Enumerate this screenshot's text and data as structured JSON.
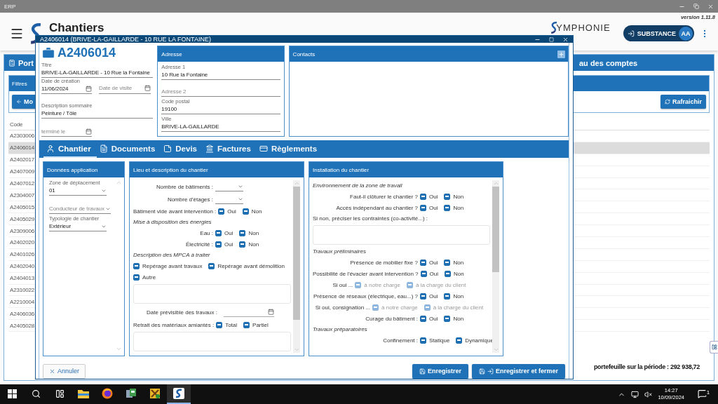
{
  "os_window": {
    "title": "ERP"
  },
  "header": {
    "app_title": "Chantiers",
    "brand": "YMPHONIE",
    "version": "version 1.11.8",
    "company_button": "SUBSTANCE",
    "avatar": "AA"
  },
  "background": {
    "left_header": "Port",
    "right_header": "au des comptes",
    "filters_title": "Filtres",
    "back_button": "Mo",
    "refresh_button": "Rafraichir",
    "column": "Code",
    "rows": [
      {
        "code": "A2303006",
        "selected": false
      },
      {
        "code": "A2406014",
        "selected": true
      },
      {
        "code": "A2402017",
        "selected": false
      },
      {
        "code": "A2407009",
        "selected": false
      },
      {
        "code": "A2407012",
        "selected": false
      },
      {
        "code": "A2304007",
        "selected": false
      },
      {
        "code": "A2405015",
        "selected": false
      },
      {
        "code": "A2405029",
        "selected": false
      },
      {
        "code": "A2309006",
        "selected": false
      },
      {
        "code": "A2402020",
        "selected": false
      },
      {
        "code": "A2401026",
        "selected": false
      },
      {
        "code": "A2402040",
        "selected": false
      },
      {
        "code": "A2404013",
        "selected": false
      },
      {
        "code": "A2310022",
        "selected": false
      },
      {
        "code": "A2210004",
        "selected": false
      },
      {
        "code": "A2406036",
        "selected": false
      },
      {
        "code": "A2405028",
        "selected": false
      }
    ],
    "total": "portefeuille sur la période : 292 938,72"
  },
  "modal": {
    "title": "A2406014 (BRIVE-LA-GAILLARDE - 10 RUE LA FONTAINE)",
    "code": "A2406014",
    "title_field": {
      "label": "Titre",
      "value": "BRIVE-LA-GAILLARDE - 10 Rue la Fontaine"
    },
    "created_field": {
      "label": "Date de création",
      "value": "11/06/2024"
    },
    "visit_field": {
      "placeholder": "Date de visite"
    },
    "summary_field": {
      "label": "Description sommaire",
      "value": "Peinture / Tôle"
    },
    "finished_field": {
      "placeholder": "terminé le"
    },
    "address": {
      "title": "Adresse",
      "fields": [
        {
          "label": "Adresse 1",
          "value": "10 Rue la Fontaine"
        },
        {
          "placeholder": "Adresse 2"
        },
        {
          "label": "Code postal",
          "value": "19100"
        },
        {
          "label": "Ville",
          "value": "BRIVE-LA-GAILLARDE"
        }
      ]
    },
    "contacts": {
      "title": "Contacts"
    },
    "tabs": [
      {
        "label": "Chantier",
        "selected": true
      },
      {
        "label": "Documents",
        "selected": false
      },
      {
        "label": "Devis",
        "selected": false
      },
      {
        "label": "Factures",
        "selected": false
      },
      {
        "label": "Règlements",
        "selected": false
      }
    ],
    "app_panel": {
      "title": "Données application",
      "fields": [
        {
          "label": "Zone de déplacement",
          "value": "01"
        },
        {
          "placeholder": "Conducteur de travaux"
        },
        {
          "label": "Typologie de chantier",
          "value": "Extérieur"
        }
      ]
    },
    "site_panel": {
      "title": "Lieu et description du chantier",
      "rows": [
        {
          "kind": "select",
          "label": "Nombre de bâtiments :"
        },
        {
          "kind": "select",
          "label": "Nombre d'étages :"
        },
        {
          "kind": "choices",
          "label": "Bâtiment vide avant intervention :",
          "options": [
            {
              "label": "Oui",
              "indeterminate": true,
              "disabled": false
            },
            {
              "label": "Non",
              "indeterminate": true,
              "disabled": false
            }
          ]
        },
        {
          "kind": "heading",
          "label": "Mise à disposition des énergies"
        },
        {
          "kind": "choices",
          "label": "Eau :",
          "options": [
            {
              "label": "Oui",
              "indeterminate": true,
              "disabled": false
            },
            {
              "label": "Non",
              "indeterminate": true,
              "disabled": false
            }
          ]
        },
        {
          "kind": "choices",
          "label": "Électricité :",
          "options": [
            {
              "label": "Oui",
              "indeterminate": true,
              "disabled": false
            },
            {
              "label": "Non",
              "indeterminate": true,
              "disabled": false
            }
          ]
        },
        {
          "kind": "heading",
          "label": "Description des MPCA à traiter"
        },
        {
          "kind": "options",
          "options": [
            {
              "label": "Repérage avant travaux",
              "indeterminate": true,
              "disabled": false
            },
            {
              "label": "Repérage avant démolition",
              "indeterminate": true,
              "disabled": false
            }
          ]
        },
        {
          "kind": "options",
          "options": [
            {
              "label": "Autre",
              "indeterminate": true,
              "disabled": false
            }
          ]
        },
        {
          "kind": "textarea"
        },
        {
          "kind": "date",
          "label": "Date prévisible des travaux :"
        },
        {
          "kind": "choices",
          "label": "Retrait des matériaux amiantés :",
          "options": [
            {
              "label": "Total",
              "indeterminate": true,
              "disabled": false
            },
            {
              "label": "Partiel",
              "indeterminate": true,
              "disabled": false
            }
          ]
        },
        {
          "kind": "textarea"
        }
      ]
    },
    "install_panel": {
      "title": "Installation du chantier",
      "rows": [
        {
          "kind": "heading",
          "label": "Environnement de la zone de travail"
        },
        {
          "kind": "choices",
          "label": "Faut-il clôturer le chantier ?",
          "options": [
            {
              "label": "Oui",
              "indeterminate": true,
              "disabled": false
            },
            {
              "label": "Non",
              "indeterminate": true,
              "disabled": false
            }
          ]
        },
        {
          "kind": "choices",
          "label": "Accès indépendant au chantier ?",
          "options": [
            {
              "label": "Oui",
              "indeterminate": true,
              "disabled": false
            },
            {
              "label": "Non",
              "indeterminate": true,
              "disabled": false
            }
          ]
        },
        {
          "kind": "note",
          "label": "Si non, préciser les contraintes (co-activité...) :"
        },
        {
          "kind": "textarea"
        },
        {
          "kind": "heading",
          "label": "Travaux préliminaires"
        },
        {
          "kind": "choices",
          "label": "Présence de mobilier fixe ?",
          "options": [
            {
              "label": "Oui",
              "indeterminate": true,
              "disabled": false
            },
            {
              "label": "Non",
              "indeterminate": true,
              "disabled": false
            }
          ]
        },
        {
          "kind": "choices",
          "label": "Possibilité de l'évacier avant intervention ?",
          "options": [
            {
              "label": "Oui",
              "indeterminate": true,
              "disabled": false
            },
            {
              "label": "Non",
              "indeterminate": true,
              "disabled": false
            }
          ]
        },
        {
          "kind": "sub",
          "label": "Si oui ...",
          "options": [
            {
              "label": "à notre charge",
              "indeterminate": true,
              "disabled": true
            },
            {
              "label": "à la charge du client",
              "indeterminate": true,
              "disabled": true
            }
          ]
        },
        {
          "kind": "choices",
          "label": "Présence de réseaux (électrique, eau...) ?",
          "options": [
            {
              "label": "Oui",
              "indeterminate": true,
              "disabled": false
            },
            {
              "label": "Non",
              "indeterminate": true,
              "disabled": false
            }
          ]
        },
        {
          "kind": "sub",
          "label": "Si oui, consignation ...",
          "options": [
            {
              "label": "à notre charge",
              "indeterminate": true,
              "disabled": true
            },
            {
              "label": "à la charge du client",
              "indeterminate": true,
              "disabled": true
            }
          ]
        },
        {
          "kind": "choices",
          "label": "Curage du bâtiment :",
          "options": [
            {
              "label": "Oui",
              "indeterminate": true,
              "disabled": false
            },
            {
              "label": "Non",
              "indeterminate": true,
              "disabled": false
            }
          ]
        },
        {
          "kind": "heading",
          "label": "Travaux préparatoires"
        },
        {
          "kind": "choices",
          "label": "Confinement :",
          "options": [
            {
              "label": "Statique",
              "indeterminate": true,
              "disabled": false
            },
            {
              "label": "Dynamique",
              "indeterminate": true,
              "disabled": false
            }
          ]
        }
      ]
    },
    "cancel_button": "Annuler",
    "save_button": "Enregistrer",
    "save_close_button": "Enregistrer et fermer"
  },
  "taskbar": {
    "apps": [
      {
        "kind": "explorer",
        "selected": false
      },
      {
        "kind": "firefox",
        "selected": false
      },
      {
        "kind": "network",
        "selected": false
      },
      {
        "kind": "tools",
        "selected": false
      },
      {
        "kind": "symphonie",
        "selected": true
      }
    ],
    "time": "14:27",
    "date": "10/09/2024",
    "notifications": "1"
  }
}
